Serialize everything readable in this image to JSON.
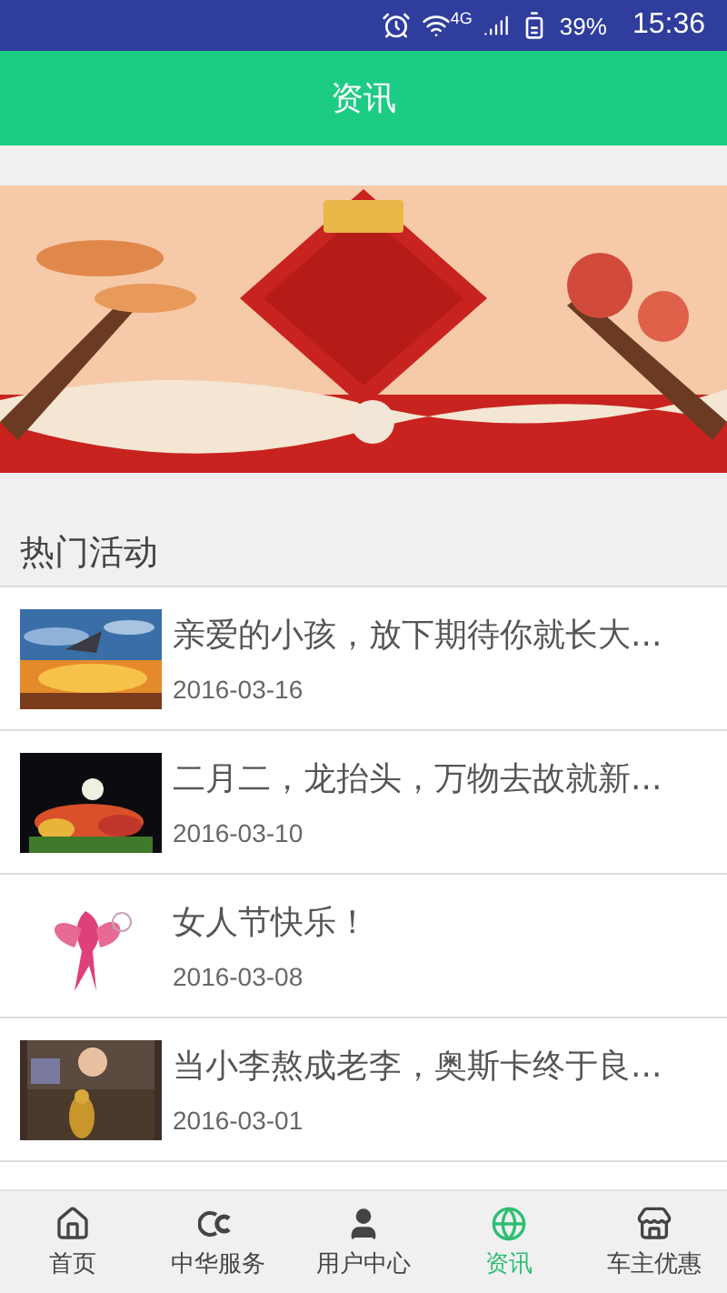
{
  "status_bar": {
    "network": "4G",
    "battery": "39%",
    "time": "15:36"
  },
  "header": {
    "title": "资讯"
  },
  "section": {
    "title": "热门活动"
  },
  "articles": [
    {
      "title": "亲爱的小孩，放下期待你就长大...",
      "date": "2016-03-16"
    },
    {
      "title": "二月二，龙抬头，万物去故就新...",
      "date": "2016-03-10"
    },
    {
      "title": "女人节快乐！",
      "date": "2016-03-08"
    },
    {
      "title": "当小李熬成老李，奥斯卡终于良...",
      "date": "2016-03-01"
    }
  ],
  "tabs": [
    {
      "label": "首页",
      "selected": false
    },
    {
      "label": "中华服务",
      "selected": false
    },
    {
      "label": "用户中心",
      "selected": false
    },
    {
      "label": "资讯",
      "selected": true
    },
    {
      "label": "车主优惠",
      "selected": false
    }
  ]
}
